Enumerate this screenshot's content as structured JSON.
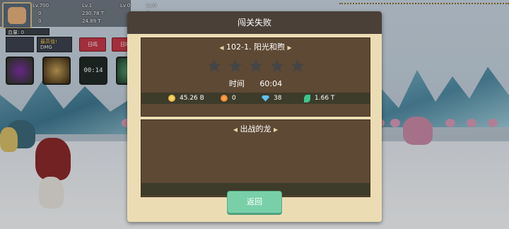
{
  "hud": {
    "player_level": "Lv.700",
    "stat1_value": "0",
    "stat2_value": "0",
    "bar_label": "血量: 0",
    "slot1_level": "Lv.1",
    "slot1_atk": "230.78 T",
    "slot1_def": "24.89 T",
    "slot2_level": "Lv.0",
    "slot2_val1": "0",
    "slot2_val2": "0",
    "slot3_level": "Lv.0",
    "slot3_val1": "0",
    "slot3_val2": "0",
    "highest_label": "最高值!",
    "dmg_label": "DMG",
    "btn_a": "日鸣",
    "btn_b": "日鸣",
    "skill_timer": "00:14",
    "wave_text": "第 5 1440 关"
  },
  "modal": {
    "title": "闯关失败",
    "stage_name": "102-1. 阳光和煦",
    "stars_total": 5,
    "stars_earned": 0,
    "time_label": "时间",
    "time_value": "60:04",
    "rewards": [
      {
        "icon": "gold-coin-icon",
        "value": "45.26 B"
      },
      {
        "icon": "orange-coin-icon",
        "value": "0"
      },
      {
        "icon": "diamond-icon",
        "value": "38"
      },
      {
        "icon": "green-leaf-icon",
        "value": "1.66 T"
      }
    ],
    "dragons_title": "出战的龙",
    "back_button": "返回"
  },
  "colors": {
    "modal_bg": "#ecdcb4",
    "header_bg": "#4a4038",
    "panel_bg": "#5e4934",
    "strip_bg": "#3d3b2a",
    "button_bg": "#79d0a8",
    "star_empty": "#4a4a4a"
  }
}
